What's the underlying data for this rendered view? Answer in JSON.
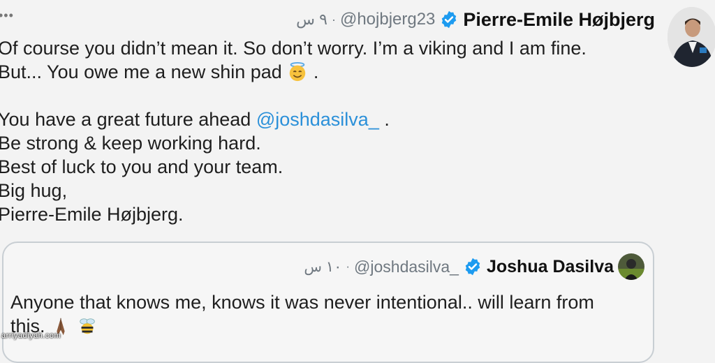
{
  "tweet": {
    "time": "٩ س",
    "dot": "·",
    "handle": "@hojbjerg23",
    "name": "Pierre-Emile Højbjerg",
    "avatar_icon": "user-photo",
    "more_icon": "•••",
    "body": {
      "line1": "Of course you didn’t mean it. So don’t worry. I’m a viking and I am fine.",
      "line2": "But... You owe me a new shin pad",
      "line2_end": ".",
      "line3_prefix": "You have a great future ahead",
      "line3_mention": "@joshdasilva_",
      "line3_suffix": ".",
      "line4": "Be strong & keep working hard.",
      "line5": "Best of luck to you and your team.",
      "line6": "Big hug,",
      "line7": "Pierre-Emile Højbjerg."
    },
    "emoji_icon": "smiling-face-with-halo"
  },
  "quote": {
    "time": "١٠ س",
    "dot": "·",
    "handle": "@joshdasilva_",
    "name": "Joshua Dasilva",
    "avatar_icon": "user-photo",
    "text_line1": "Anyone that knows me, knows it was never intentional.. will learn from",
    "text_line2": "this.",
    "emoji_icons": [
      "folded-hands",
      "bee"
    ]
  },
  "watermark": "arriyadiyah.com",
  "colors": {
    "verified": "#1d9bf0",
    "mention": "#2b90d9",
    "muted": "#6f7880",
    "border": "#c8ced3"
  }
}
